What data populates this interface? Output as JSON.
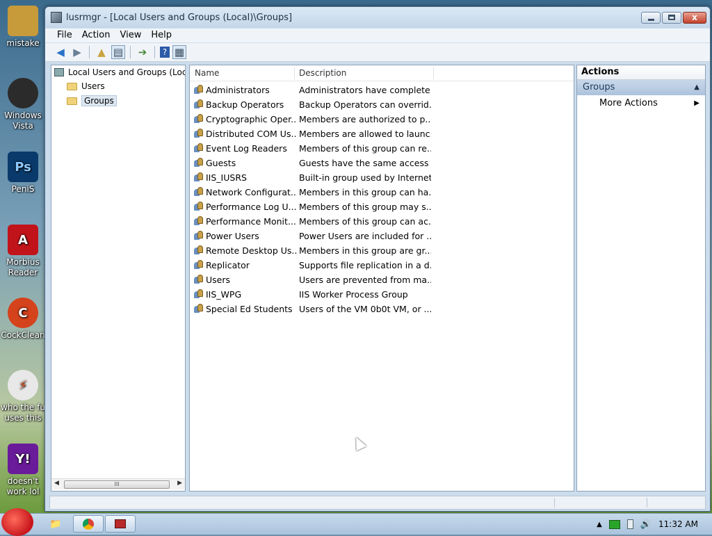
{
  "window": {
    "title": "lusrmgr - [Local Users and Groups (Local)\\Groups]",
    "close_glyph": "x"
  },
  "menu": [
    "File",
    "Action",
    "View",
    "Help"
  ],
  "toolbar": {
    "icons": [
      "back-icon",
      "forward-icon",
      "up-folder-icon",
      "show-hide-tree-icon",
      "export-list-icon",
      "help-icon",
      "action-pane-icon"
    ]
  },
  "tree": {
    "root": "Local Users and Groups (Local)",
    "items": [
      "Users",
      "Groups"
    ],
    "selected": "Groups",
    "scroll_thumb": "III"
  },
  "list": {
    "columns": [
      "Name",
      "Description"
    ],
    "rows": [
      {
        "name": "Administrators",
        "desc": "Administrators have complete ..."
      },
      {
        "name": "Backup Operators",
        "desc": "Backup Operators can overrid..."
      },
      {
        "name": "Cryptographic Oper...",
        "desc": "Members are authorized to p..."
      },
      {
        "name": "Distributed COM Us...",
        "desc": "Members are allowed to launc..."
      },
      {
        "name": "Event Log Readers",
        "desc": "Members of this group can re..."
      },
      {
        "name": "Guests",
        "desc": "Guests have the same access ..."
      },
      {
        "name": "IIS_IUSRS",
        "desc": "Built-in group used by Internet..."
      },
      {
        "name": "Network Configurat...",
        "desc": "Members in this group can ha..."
      },
      {
        "name": "Performance Log U...",
        "desc": "Members of this group may s..."
      },
      {
        "name": "Performance Monit...",
        "desc": "Members of this group can ac..."
      },
      {
        "name": "Power Users",
        "desc": "Power Users are included for ..."
      },
      {
        "name": "Remote Desktop Us...",
        "desc": "Members in this group are gr..."
      },
      {
        "name": "Replicator",
        "desc": "Supports file replication in a d..."
      },
      {
        "name": "Users",
        "desc": "Users are prevented from ma..."
      },
      {
        "name": "IIS_WPG",
        "desc": "IIS Worker Process Group"
      },
      {
        "name": "Special Ed Students",
        "desc": "Users of the VM 0b0t VM, or ..."
      }
    ]
  },
  "actions": {
    "header": "Actions",
    "section": "Groups",
    "items": [
      "More Actions"
    ]
  },
  "desktop_icons": [
    {
      "label": "mistake",
      "color": "#c79a3a",
      "glyph": ""
    },
    {
      "label": "Windows Vista",
      "color": "#2b2b2b",
      "glyph": ""
    },
    {
      "label": "PeniS",
      "color": "#0a3a6b",
      "glyph": "Ps"
    },
    {
      "label": "Morbius Reader",
      "color": "#c0141a",
      "glyph": "A"
    },
    {
      "label": "CockClean",
      "color": "#d4431c",
      "glyph": "C"
    },
    {
      "label": "who the fu uses this",
      "color": "#e8e8e8",
      "glyph": "⚡"
    },
    {
      "label": "doesn't work lol",
      "color": "#6a1b9a",
      "glyph": "Y!"
    }
  ],
  "taskbar": {
    "clock": "11:32 AM"
  },
  "colors": {
    "window_frame": "#cbdcec",
    "selection": "#dde7f1",
    "actions_section": "#adc3dc"
  }
}
